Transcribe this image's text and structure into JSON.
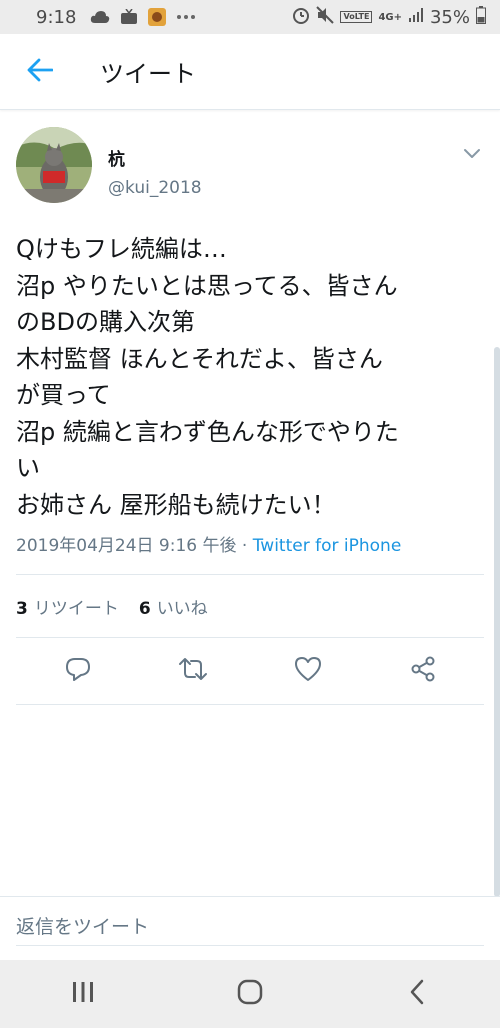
{
  "status_bar": {
    "time": "9:18",
    "network": "4G+",
    "volte": "VoLTE",
    "battery_pct": "35%"
  },
  "header": {
    "title": "ツイート"
  },
  "tweet": {
    "author_name": "杭",
    "author_handle": "@kui_2018",
    "text": "Qけもフレ続編は…\n沼p やりたいとは思ってる、皆さん\nのBDの購入次第\n木村監督 ほんとそれだよ、皆さん\nが買って\n沼p 続編と言わず色んな形でやりた\nい\nお姉さん 屋形船も続けたい！",
    "timestamp": "2019年04月24日 9:16 午後 · ",
    "source": "Twitter for iPhone",
    "retweet_count": "3",
    "retweet_label": "リツイート",
    "like_count": "6",
    "like_label": "いいね"
  },
  "reply": {
    "placeholder": "返信をツイート"
  },
  "colors": {
    "accent": "#1da1f2",
    "source_link": "#1b95e0",
    "secondary_text": "#657786",
    "icon_gray": "#657786"
  }
}
